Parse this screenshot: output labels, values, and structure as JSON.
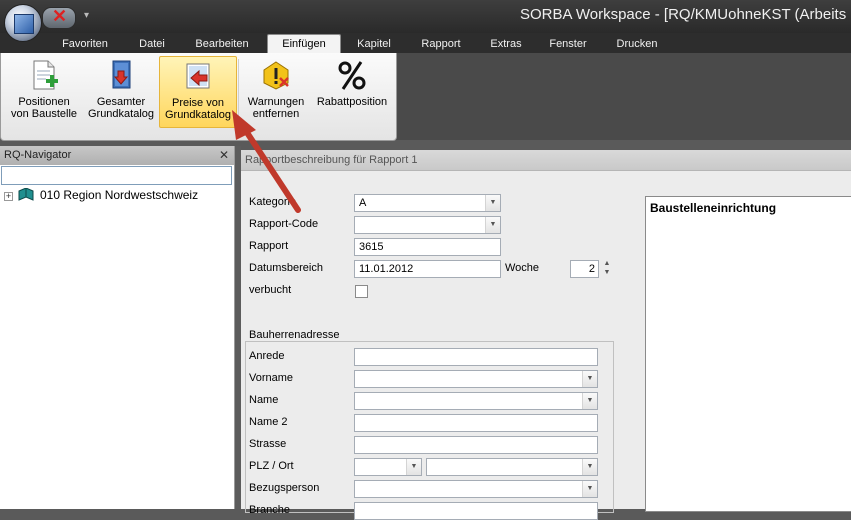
{
  "window": {
    "title": "SORBA Workspace - [RQ/KMUohneKST (Arbeits"
  },
  "menu_tabs": [
    {
      "label": "Favoriten"
    },
    {
      "label": "Datei"
    },
    {
      "label": "Bearbeiten"
    },
    {
      "label": "Einfügen"
    },
    {
      "label": "Kapitel"
    },
    {
      "label": "Rapport"
    },
    {
      "label": "Extras"
    },
    {
      "label": "Fenster"
    },
    {
      "label": "Drucken"
    }
  ],
  "active_tab": "Einfügen",
  "ribbon": {
    "buttons": [
      {
        "line1": "Positionen",
        "line2": "von Baustelle",
        "icon": "document-add-icon"
      },
      {
        "line1": "Gesamter",
        "line2": "Grundkatalog",
        "icon": "book-download-icon"
      },
      {
        "line1": "Preise von",
        "line2": "Grundkatalog",
        "icon": "price-import-icon",
        "highlighted": true
      },
      {
        "line1": "Warnungen",
        "line2": "entfernen",
        "icon": "warning-remove-icon"
      },
      {
        "line1": "Rabattposition",
        "line2": "",
        "icon": "percent-icon"
      }
    ]
  },
  "navigator": {
    "title": "RQ-Navigator",
    "close_glyph": "✕",
    "tree": [
      {
        "label": "010 Region Nordwestschweiz",
        "expander": "+"
      }
    ]
  },
  "content": {
    "header": "Rapportbeschreibung für Rapport 1",
    "fields": {
      "kategorie": {
        "label": "Kategorie",
        "value": "A"
      },
      "rapport_code": {
        "label": "Rapport-Code",
        "value": ""
      },
      "rapport": {
        "label": "Rapport",
        "value": "3615"
      },
      "datumsbereich": {
        "label": "Datumsbereich",
        "value": "11.01.2012"
      },
      "woche": {
        "label": "Woche",
        "value": "2"
      },
      "verbucht": {
        "label": "verbucht",
        "checked": false
      }
    },
    "address": {
      "section_label": "Bauherrenadresse",
      "fields": [
        {
          "label": "Anrede"
        },
        {
          "label": "Vorname"
        },
        {
          "label": "Name"
        },
        {
          "label": "Name 2"
        },
        {
          "label": "Strasse"
        },
        {
          "label": "PLZ / Ort"
        },
        {
          "label": "Bezugsperson"
        },
        {
          "label": "Branche"
        }
      ]
    },
    "notes": {
      "title": "Baustelleneinrichtung"
    }
  },
  "colors": {
    "title_bar": "#2d2d2d",
    "ribbon_highlight": "#ffd65c",
    "arrow": "#c0392b"
  }
}
